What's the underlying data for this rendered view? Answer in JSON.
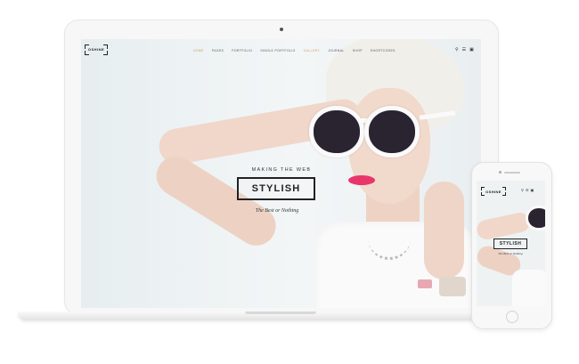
{
  "brand": {
    "logo_text": "OSHINE"
  },
  "nav": {
    "items": [
      "Home",
      "Pages",
      "Portfolio",
      "Single Portfolio",
      "Gallery",
      "Journal",
      "Shop",
      "Shortcodes"
    ],
    "active_index": 0,
    "accent_index": 4,
    "icons": [
      "search-icon",
      "menu-icon",
      "cart-icon"
    ]
  },
  "hero": {
    "tagline_top": "MAKING THE WEB",
    "headline": "STYLISH",
    "tagline_bottom": "The Best or Nothing"
  },
  "colors": {
    "accent": "#c9a064",
    "lips": "#e8366b",
    "text": "#222222"
  }
}
